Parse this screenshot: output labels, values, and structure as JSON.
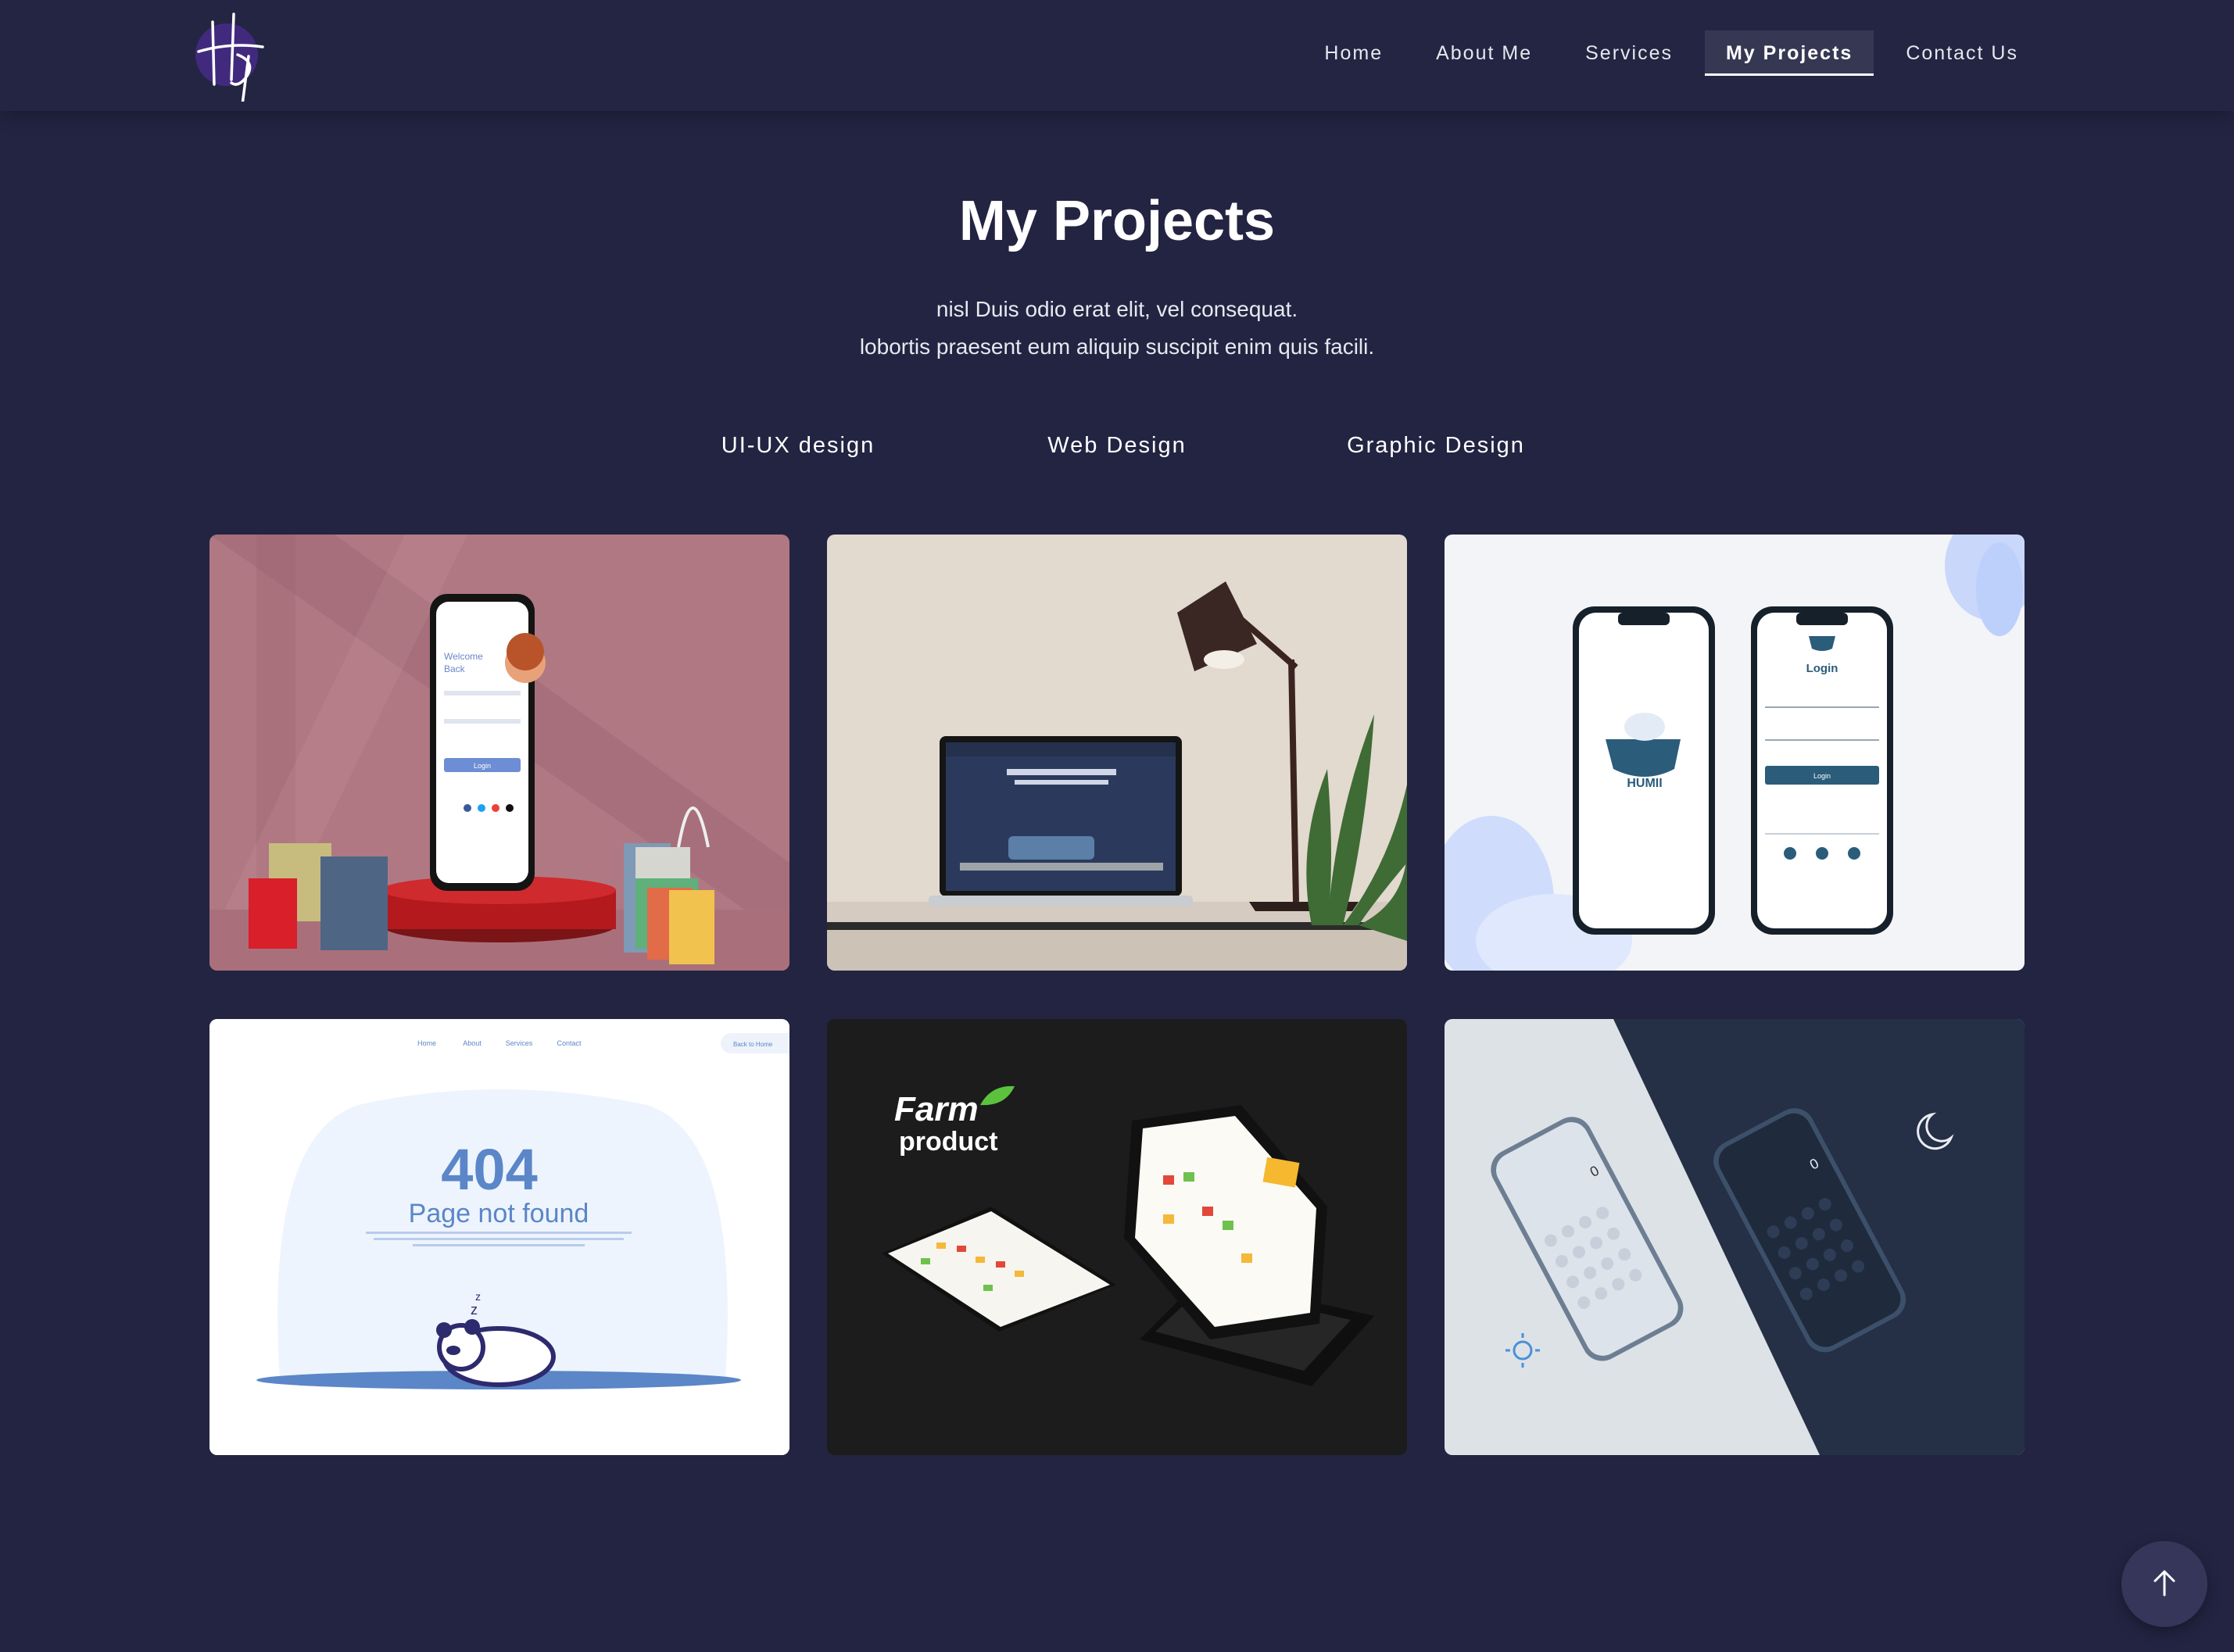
{
  "nav": {
    "logo_alt": "HDT",
    "items": [
      {
        "label": "Home",
        "active": false
      },
      {
        "label": "About Me",
        "active": false
      },
      {
        "label": "Services",
        "active": false
      },
      {
        "label": "My Projects",
        "active": true
      },
      {
        "label": "Contact Us",
        "active": false
      }
    ]
  },
  "hero": {
    "title": "My Projects",
    "subtitle_line1": "nisl Duis odio erat elit, vel consequat.",
    "subtitle_line2": "lobortis praesent eum aliquip suscipit enim quis facili."
  },
  "filters": [
    {
      "label": "UI-UX design"
    },
    {
      "label": "Web Design"
    },
    {
      "label": "Graphic Design"
    }
  ],
  "projects": [
    {
      "name": "Shopping app login mockup",
      "text1": "Welcome",
      "text2": "Back",
      "button": "Login"
    },
    {
      "name": "Interior website laptop mockup"
    },
    {
      "name": "Humii app mockup",
      "brand": "HUMII",
      "heading": "Login",
      "button": "Login"
    },
    {
      "name": "404 page",
      "code": "404",
      "message": "Page not found",
      "nav": [
        "Home",
        "About",
        "Services",
        "Contact"
      ],
      "back": "Back to Home"
    },
    {
      "name": "Farm product tablet mockup",
      "line1": "Farm",
      "line2": "product"
    },
    {
      "name": "Calculator app light/dark mockup",
      "display": "0"
    }
  ],
  "colors": {
    "background": "#232442",
    "nav_active_bg": "#363853",
    "text": "#ffffff"
  },
  "back_to_top": {
    "icon": "arrow-up-icon"
  }
}
